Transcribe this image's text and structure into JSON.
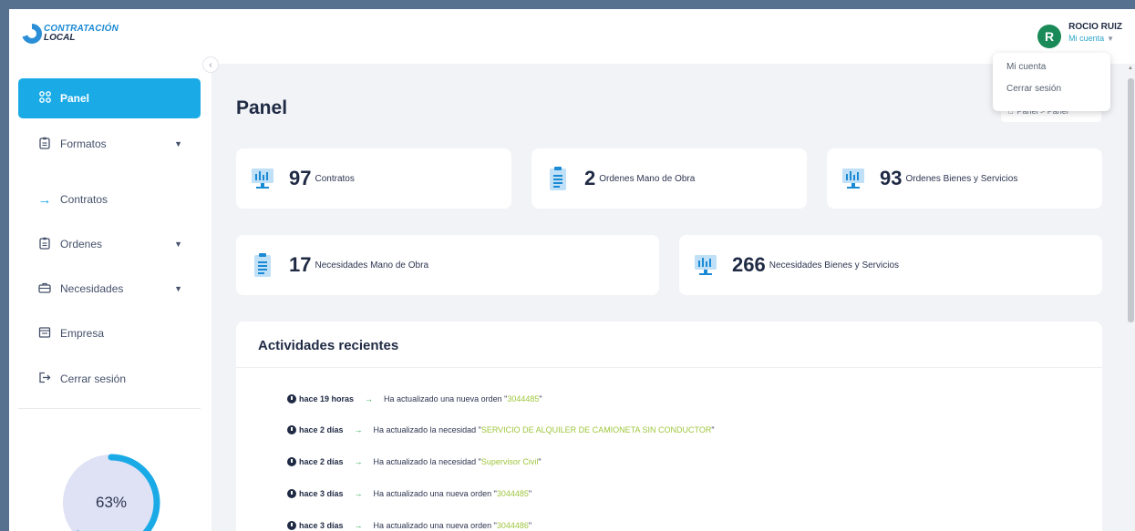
{
  "app": {
    "logo_line1": "CONTRATACIÓN",
    "logo_line2": "LOCAL"
  },
  "user": {
    "initial": "R",
    "name": "ROCIO RUIZ",
    "menu_toggle": "Mi cuenta"
  },
  "dropdown": {
    "items": [
      "Mi cuenta",
      "Cerrar sesión"
    ]
  },
  "sidebar": {
    "items": [
      {
        "label": "Panel",
        "icon": "grid-icon",
        "has_arrow": false,
        "active": true
      },
      {
        "label": "Formatos",
        "icon": "clipboard-icon",
        "has_arrow": true,
        "active": false
      },
      {
        "label": "Contratos",
        "icon": "arrow-right-icon",
        "has_arrow": false,
        "active": false
      },
      {
        "label": "Ordenes",
        "icon": "clipboard-icon",
        "has_arrow": true,
        "active": false
      },
      {
        "label": "Necesidades",
        "icon": "briefcase-icon",
        "has_arrow": true,
        "active": false
      },
      {
        "label": "Empresa",
        "icon": "building-icon",
        "has_arrow": false,
        "active": false
      },
      {
        "label": "Cerrar sesión",
        "icon": "logout-icon",
        "has_arrow": false,
        "active": false
      }
    ],
    "progress_percent": 63,
    "progress_label": "63%"
  },
  "main": {
    "page_title": "Panel",
    "breadcrumb": "Panel > Panel",
    "stats": [
      {
        "value": "97",
        "label": "Contratos",
        "icon": "monitor-chart-icon"
      },
      {
        "value": "2",
        "label": "Ordenes Mano de Obra",
        "icon": "document-icon"
      },
      {
        "value": "93",
        "label": "Ordenes Bienes y Servicios",
        "icon": "monitor-chart-icon"
      },
      {
        "value": "17",
        "label": "Necesidades Mano de Obra",
        "icon": "document-icon"
      },
      {
        "value": "266",
        "label": "Necesidades Bienes y Servicios",
        "icon": "monitor-chart-icon"
      }
    ],
    "activity": {
      "title": "Actividades recientes",
      "items": [
        {
          "when": "hace 19 horas",
          "text": "Ha actualizado una nueva orden",
          "ref": "3044485"
        },
        {
          "when": "hace 2 días",
          "text": "Ha actualizado la necesidad",
          "ref": "SERVICIO DE ALQUILER DE CAMIONETA SIN CONDUCTOR"
        },
        {
          "when": "hace 2 días",
          "text": "Ha actualizado la necesidad",
          "ref": "Supervisor Civil"
        },
        {
          "when": "hace 3 días",
          "text": "Ha actualizado una nueva orden",
          "ref": "3044485"
        },
        {
          "when": "hace 3 días",
          "text": "Ha actualizado una nueva orden",
          "ref": "3044486"
        }
      ]
    }
  },
  "colors": {
    "accent": "#1aaae6",
    "avatar": "#1a8a58",
    "progress_ring": "#1aaae6",
    "ref_text": "#9ec63c"
  }
}
